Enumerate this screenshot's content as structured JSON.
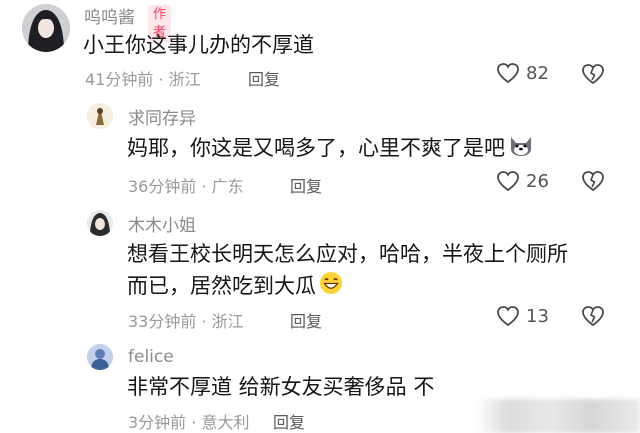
{
  "comment": {
    "author": "呜呜酱",
    "badge": "作者",
    "text": "小王你这事儿办的不厚道",
    "time_location": "41分钟前 · 浙江",
    "reply_label": "回复",
    "likes": "82"
  },
  "replies": [
    {
      "author": "求同存异",
      "text": "妈耶，你这是又喝多了，心里不爽了是吧",
      "emoji": "dog-face-emoji",
      "time_location": "36分钟前 · 广东",
      "reply_label": "回复",
      "likes": "26"
    },
    {
      "author": "木木小姐",
      "text_line1": "想看王校长明天怎么应对，哈哈，半夜上个厕所",
      "text_line2": "而已，居然吃到大瓜",
      "emoji": "grinning-face-emoji",
      "time_location": "33分钟前 · 浙江",
      "reply_label": "回复",
      "likes": "13"
    },
    {
      "author": "felice",
      "text": "非常不厚道 给新女友买奢侈品 不",
      "time_location": "3分钟前 · 意大利",
      "reply_label": "回复"
    }
  ],
  "icons": {
    "like": "heart-outline-icon",
    "dislike": "broken-heart-icon"
  },
  "colors": {
    "badge_text": "#ff3b5c",
    "badge_bg": "#fde7ea",
    "meta": "#9a9a9a"
  }
}
